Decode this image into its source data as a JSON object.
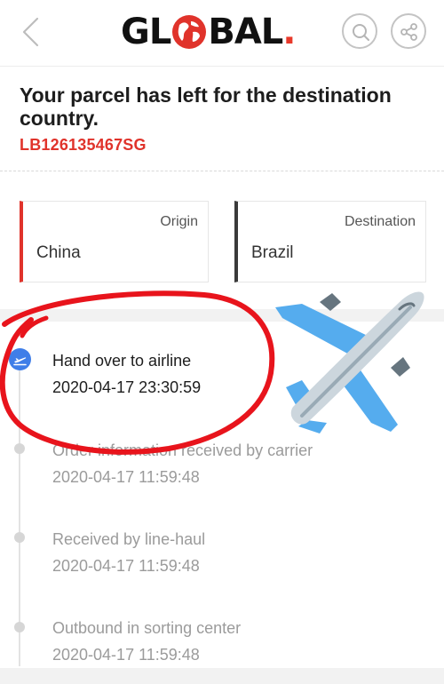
{
  "header": {
    "logo_text_left": "GL",
    "logo_text_right": "BAL",
    "logo_dot": ".",
    "back_icon": "chevron-left-icon",
    "search_icon": "search-icon",
    "share_icon": "share-icon"
  },
  "parcel": {
    "status_title": "Your parcel has left for the destination country.",
    "tracking_number": "LB126135467SG"
  },
  "route": {
    "origin_label": "Origin",
    "origin_value": "China",
    "destination_label": "Destination",
    "destination_value": "Brazil"
  },
  "timeline": [
    {
      "title": "Hand over to airline",
      "time": "2020-04-17 23:30:59",
      "icon": "airplane-departure-icon"
    },
    {
      "title": "Order information received by carrier",
      "time": "2020-04-17 11:59:48"
    },
    {
      "title": "Received by line-haul",
      "time": "2020-04-17 11:59:48"
    },
    {
      "title": "Outbound in sorting center",
      "time": "2020-04-17 11:59:48"
    }
  ],
  "colors": {
    "accent_red": "#e0332b",
    "active_blue": "#3f7ee8",
    "scribble_red": "#e8141c",
    "plane_blue": "#55acee"
  }
}
